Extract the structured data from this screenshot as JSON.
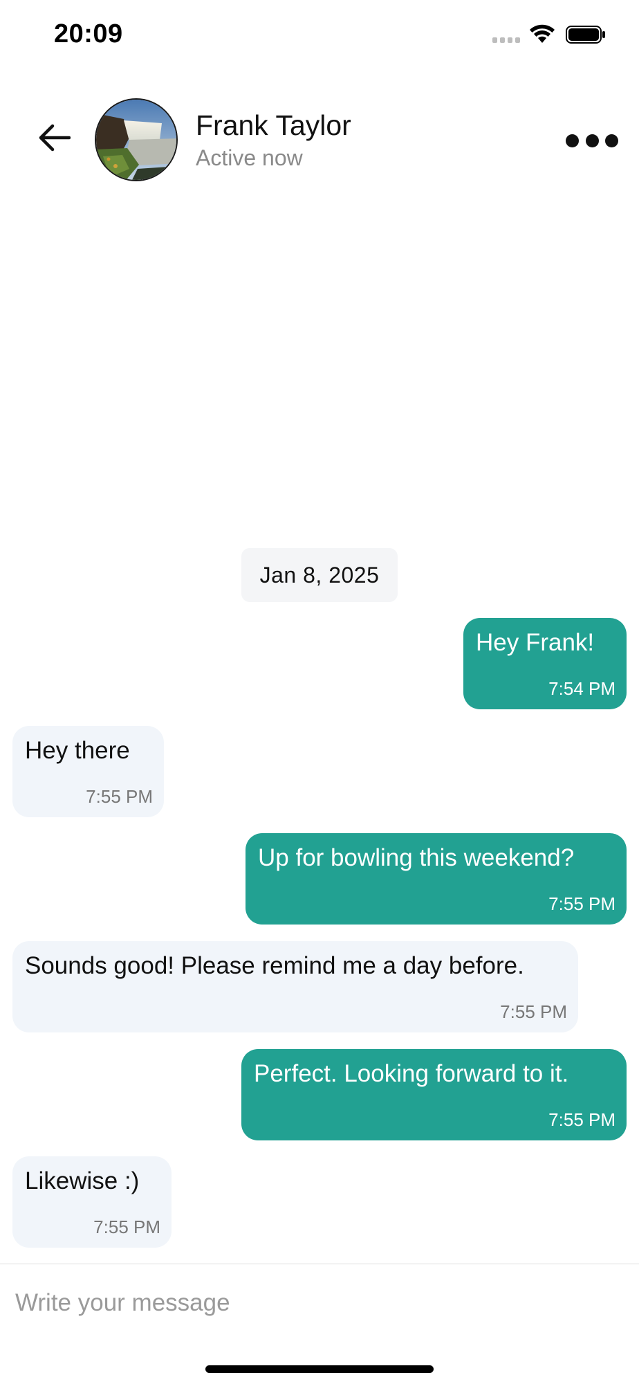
{
  "status_bar": {
    "time": "20:09"
  },
  "header": {
    "contact_name": "Frank Taylor",
    "contact_status": "Active now",
    "back_icon": "arrow-left-icon",
    "more_icon": "more-horizontal-icon"
  },
  "conversation": {
    "date": "Jan 8, 2025",
    "messages": [
      {
        "direction": "out",
        "text": "Hey Frank!",
        "time": "7:54 PM"
      },
      {
        "direction": "in",
        "text": "Hey there",
        "time": "7:55 PM"
      },
      {
        "direction": "out",
        "text": "Up for bowling this weekend?",
        "time": "7:55 PM"
      },
      {
        "direction": "in",
        "text": "Sounds good! Please remind me a day before.",
        "time": "7:55 PM"
      },
      {
        "direction": "out",
        "text": "Perfect. Looking forward to it.",
        "time": "7:55 PM"
      },
      {
        "direction": "in",
        "text": "Likewise :)",
        "time": "7:55 PM"
      }
    ]
  },
  "composer": {
    "placeholder": "Write your message",
    "value": ""
  },
  "colors": {
    "outgoing_bubble": "#22a192",
    "incoming_bubble": "#f1f5fa",
    "date_chip": "#f4f5f7",
    "secondary_text": "#8a8a8a"
  }
}
